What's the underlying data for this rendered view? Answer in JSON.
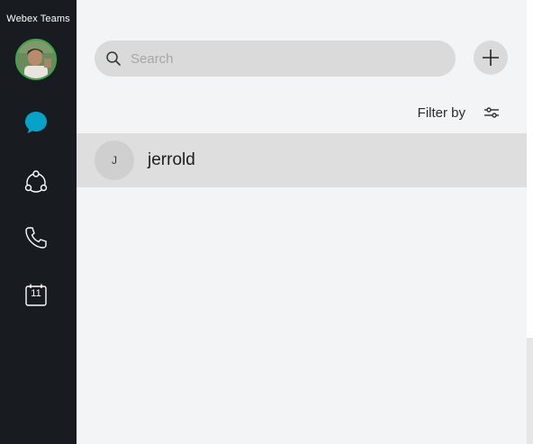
{
  "app": {
    "title": "Webex Teams"
  },
  "sidebar": {
    "items": [
      {
        "name": "messaging",
        "icon": "chat-bubble-icon",
        "active": true
      },
      {
        "name": "teams",
        "icon": "teams-icon",
        "active": false
      },
      {
        "name": "calls",
        "icon": "phone-icon",
        "active": false
      },
      {
        "name": "meetings",
        "icon": "calendar-icon",
        "active": false,
        "day": "11"
      }
    ]
  },
  "search": {
    "placeholder": "Search",
    "value": ""
  },
  "filter": {
    "label": "Filter by"
  },
  "spaces": [
    {
      "initial": "J",
      "name": "jerrold"
    }
  ],
  "colors": {
    "rail_bg": "#181b20",
    "accent": "#07a2c7",
    "presence": "#3fa54a",
    "main_bg": "#f3f4f5",
    "row_bg": "#dedede"
  }
}
